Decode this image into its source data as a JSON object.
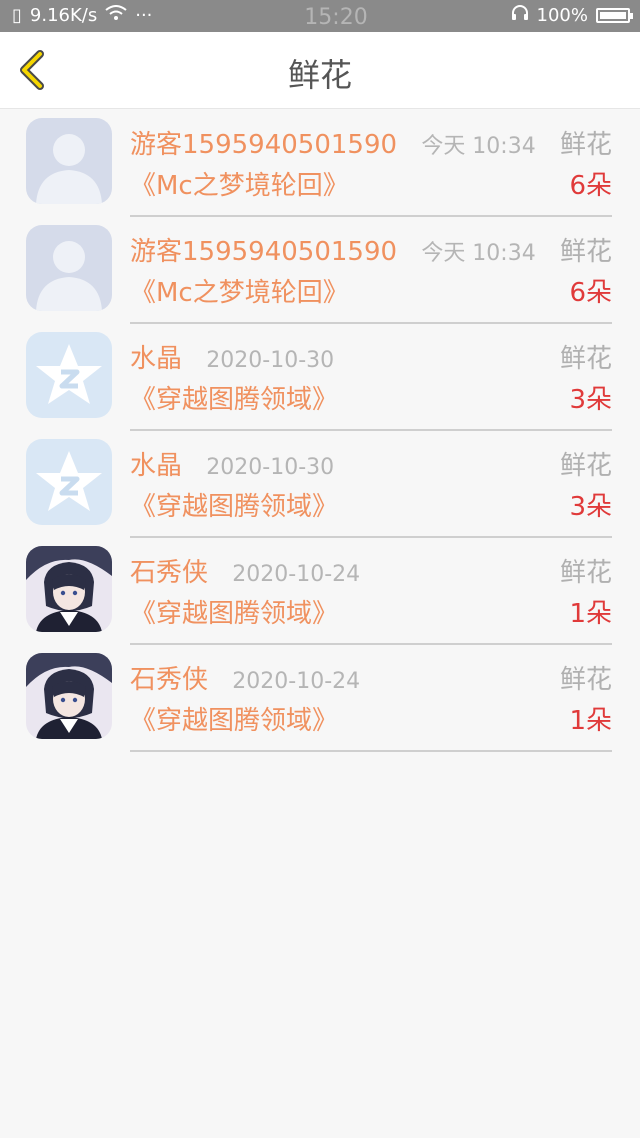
{
  "status": {
    "speed": "9.16K/s",
    "time": "15:20",
    "battery": "100%"
  },
  "header": {
    "title": "鲜花"
  },
  "items": [
    {
      "name": "游客1595940501590",
      "time": "今天 10:34",
      "type": "鲜花",
      "book": "《Mc之梦境轮回》",
      "count": "6朵",
      "avatar": "default-avatar-icon"
    },
    {
      "name": "游客1595940501590",
      "time": "今天 10:34",
      "type": "鲜花",
      "book": "《Mc之梦境轮回》",
      "count": "6朵",
      "avatar": "default-avatar-icon"
    },
    {
      "name": "水晶",
      "time": "2020-10-30",
      "type": "鲜花",
      "book": "《穿越图腾领域》",
      "count": "3朵",
      "avatar": "qq-star-avatar-icon"
    },
    {
      "name": "水晶",
      "time": "2020-10-30",
      "type": "鲜花",
      "book": "《穿越图腾领域》",
      "count": "3朵",
      "avatar": "qq-star-avatar-icon"
    },
    {
      "name": "石秀侠",
      "time": "2020-10-24",
      "type": "鲜花",
      "book": "《穿越图腾领域》",
      "count": "1朵",
      "avatar": "anime-avatar-icon"
    },
    {
      "name": "石秀侠",
      "time": "2020-10-24",
      "type": "鲜花",
      "book": "《穿越图腾领域》",
      "count": "1朵",
      "avatar": "anime-avatar-icon"
    }
  ]
}
